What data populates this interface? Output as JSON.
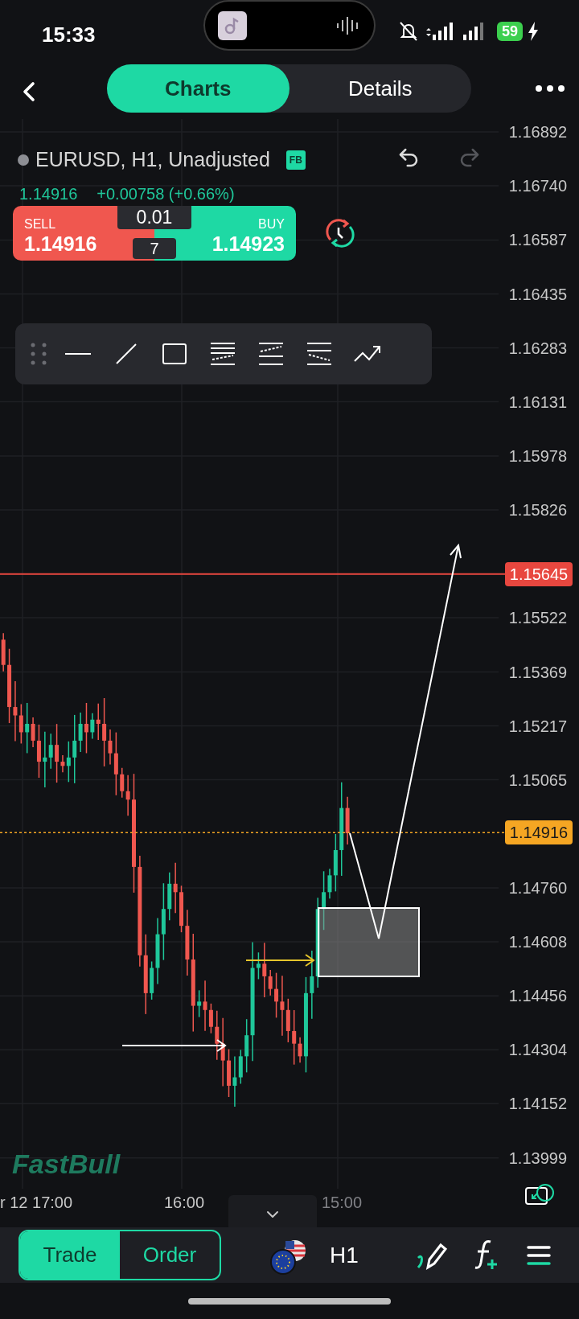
{
  "status_bar": {
    "time": "15:33",
    "battery": "59"
  },
  "header": {
    "tabs": [
      {
        "label": "Charts",
        "selected": true
      },
      {
        "label": "Details",
        "selected": false
      }
    ]
  },
  "symbol": {
    "title": "EURUSD, H1, Unadjusted",
    "badge": "FB",
    "price": "1.14916",
    "change": "+0.00758 (+0.66%)"
  },
  "trade_widget": {
    "sell_label": "SELL",
    "sell_price": "1.14916",
    "lot": "0.01",
    "spread": "7",
    "buy_label": "BUY",
    "buy_price": "1.14923"
  },
  "price_axis": {
    "labels": [
      "1.16892",
      "1.16740",
      "1.16587",
      "1.16435",
      "1.16283",
      "1.16131",
      "1.15978",
      "1.15826",
      "1.15522",
      "1.15369",
      "1.15217",
      "1.15065",
      "1.14760",
      "1.14608",
      "1.14456",
      "1.14304",
      "1.14152",
      "1.13999"
    ]
  },
  "price_lines": [
    {
      "label": "1.15645",
      "kind": "solid",
      "color": "#e8473f"
    },
    {
      "label": "1.14916",
      "kind": "dotted",
      "color": "#f5a623"
    }
  ],
  "watermark": "FastBull",
  "time_axis": {
    "labels": [
      "r 12 17:00",
      "16:00",
      "15:00"
    ]
  },
  "bottom_bar": {
    "modes": [
      {
        "label": "Trade",
        "selected": true
      },
      {
        "label": "Order",
        "selected": false
      }
    ],
    "timeframe": "H1"
  }
}
